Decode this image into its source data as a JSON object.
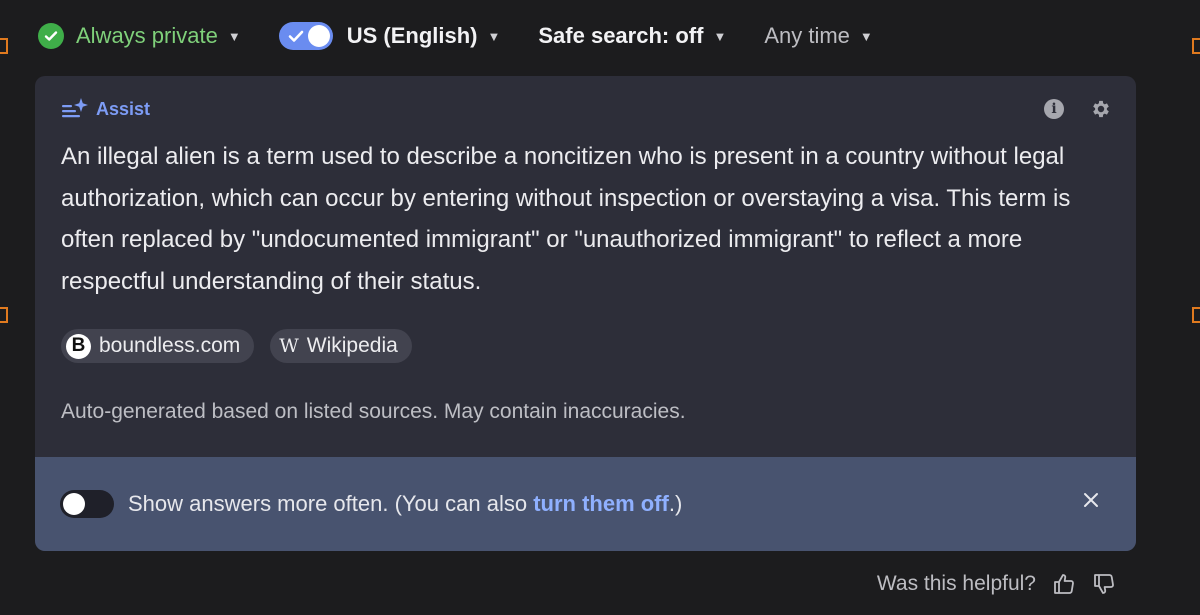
{
  "filters": {
    "privacy": "Always private",
    "region": "US (English)",
    "safe_search": "Safe search: off",
    "time": "Any time"
  },
  "assist": {
    "label": "Assist",
    "answer": "An illegal alien is a term used to describe a noncitizen who is present in a country without legal authorization, which can occur by entering without inspection or overstaying a visa. This term is often replaced by \"undocumented immigrant\" or \"unauthorized immigrant\" to reflect a more respectful understanding of their status.",
    "sources": [
      {
        "icon": "boundless-logo-icon",
        "logo_letter": "B",
        "label": "boundless.com"
      },
      {
        "icon": "wikipedia-logo-icon",
        "logo_letter": "W",
        "label": "Wikipedia"
      }
    ],
    "disclaimer": "Auto-generated based on listed sources. May contain inaccuracies.",
    "info_glyph": "i"
  },
  "promo": {
    "text_before": "Show answers more often. (You can also ",
    "link": "turn them off",
    "text_after": ".)"
  },
  "feedback": {
    "question": "Was this helpful?"
  },
  "colors": {
    "accent": "#7d9cf5",
    "private_green": "#3fae49",
    "card_bg": "#2d2e39",
    "promo_bg": "#48536f",
    "link": "#8fb0ff"
  }
}
